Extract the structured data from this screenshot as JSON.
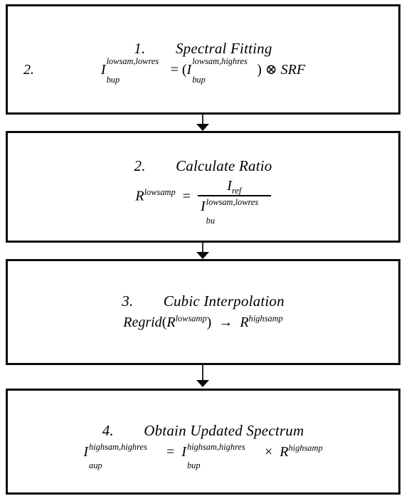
{
  "diagram": {
    "title": "Spectral update processing flowchart",
    "orientation": "vertical-top-down",
    "background_color": "#ffffff",
    "border_color": "#0b0b0b",
    "arrow_color": "#0b0b0b",
    "steps": [
      {
        "number": "1.",
        "title": "Spectral Fitting",
        "title_line": "1.  Spectral Fitting",
        "stray_enumerator": "2.",
        "formula_plain": "I_bup^{lowsam,lowres} = ( I_bup^{lowsam,highres} ) ⊗ SRF",
        "lhs": {
          "base": "I",
          "sup": "lowsam,lowres",
          "sub": "bup"
        },
        "relation": "=",
        "open_paren": "(",
        "rhs_term": {
          "base": "I",
          "sup": "lowsam,highres",
          "sub": "bup"
        },
        "close_paren": ")",
        "operator": "⊗",
        "operand": "SRF"
      },
      {
        "number": "2.",
        "title": "Calculate Ratio",
        "title_line": "2.  Calculate Ratio",
        "formula_plain": "R^{lowsamp} = I_ref / I_bu^{lowsam,lowres}",
        "lhs": {
          "base": "R",
          "sup": "lowsamp"
        },
        "relation": "=",
        "numerator": {
          "base": "I",
          "sub": "ref"
        },
        "denominator": {
          "base": "I",
          "sup": "lowsam,lowres",
          "sub": "bu"
        }
      },
      {
        "number": "3.",
        "title": "Cubic Interpolation",
        "title_line": "3.  Cubic Interpolation",
        "formula_plain": "Regrid( R^{lowsamp} ) → R^{highsamp}",
        "function_name": "Regrid",
        "open_paren": "(",
        "argument": {
          "base": "R",
          "sup": "lowsamp"
        },
        "close_paren": ")",
        "operator": "→",
        "result": {
          "base": "R",
          "sup": "highsamp"
        }
      },
      {
        "number": "4.",
        "title": "Obtain Updated Spectrum",
        "title_line": "4.  Obtain Updated Spectrum",
        "formula_plain": "I_aup^{highsam,highres} = I_bup^{highsam,highres} × R^{highsamp}",
        "lhs": {
          "base": "I",
          "sup": "highsam,highres",
          "sub": "aup"
        },
        "relation": "=",
        "rhs_term": {
          "base": "I",
          "sup": "highsam,highres",
          "sub": "bup"
        },
        "operator": "×",
        "operand": {
          "base": "R",
          "sup": "highsamp"
        }
      }
    ],
    "connectors": [
      {
        "from": "step-1",
        "to": "step-2",
        "glyph": "down-arrow"
      },
      {
        "from": "step-2",
        "to": "step-3",
        "glyph": "down-arrow"
      },
      {
        "from": "step-3",
        "to": "step-4",
        "glyph": "down-arrow"
      }
    ]
  }
}
